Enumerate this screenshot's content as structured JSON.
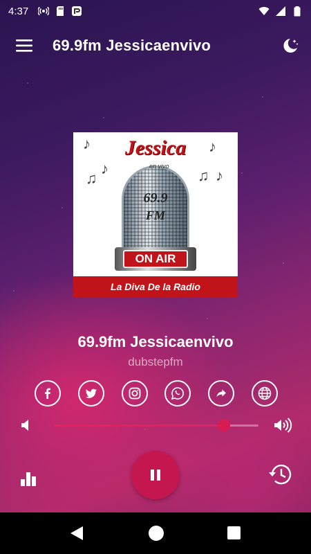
{
  "status_bar": {
    "time": "4:37",
    "icons_left": [
      "hotspot-icon",
      "sd-card-icon",
      "app-notification-icon"
    ],
    "icons_right": [
      "wifi-icon",
      "cell-signal-icon",
      "battery-icon"
    ]
  },
  "app_bar": {
    "title": "69.9fm Jessicaenvivo",
    "menu_icon": "hamburger-menu-icon",
    "night_mode_icon": "moon-stars-icon"
  },
  "cover_art": {
    "title": "Jessica",
    "subtitle": "en vivo",
    "frequency": "69.9",
    "band": "FM",
    "on_air": "ON AIR",
    "banner": "La Diva De la Radio"
  },
  "station": {
    "name": "69.9fm Jessicaenvivo",
    "genre": "dubstepfm"
  },
  "social": [
    {
      "name": "facebook",
      "icon": "facebook-icon"
    },
    {
      "name": "twitter",
      "icon": "twitter-icon"
    },
    {
      "name": "instagram",
      "icon": "instagram-icon"
    },
    {
      "name": "whatsapp",
      "icon": "whatsapp-icon"
    },
    {
      "name": "share",
      "icon": "share-icon"
    },
    {
      "name": "website",
      "icon": "globe-icon"
    }
  ],
  "volume": {
    "level": 0.83,
    "accent_color": "#e0235f"
  },
  "player": {
    "state": "playing",
    "play_button_color": "#c5174f",
    "play_icon": "pause-icon"
  },
  "colors": {
    "background_top": "#2a1450",
    "background_bottom": "#b12b6a",
    "banner_red": "#c0141a"
  }
}
